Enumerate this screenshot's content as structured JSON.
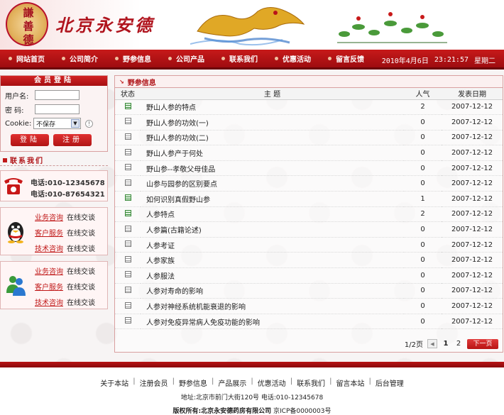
{
  "header": {
    "seal_chars": [
      "謙",
      "善",
      "德"
    ],
    "company_name": "北京永安德"
  },
  "nav": {
    "items": [
      "网站首页",
      "公司简介",
      "野参信息",
      "公司产品",
      "联系我们",
      "优惠活动",
      "留言反馈"
    ],
    "date": "2010年4月6日",
    "time": "23:21:57",
    "weekday": "星期二"
  },
  "login": {
    "title": "会员登陆",
    "username_label": "用户名:",
    "password_label": "密 码:",
    "cookie_label": "Cookie:",
    "cookie_value": "不保存",
    "login_button": "登陆",
    "register_button": "注册"
  },
  "contact": {
    "title": "联系我们",
    "phone1": "电话:010-12345678",
    "phone2": "电话:010-87654321",
    "qq_rows": [
      {
        "service": "业务咨询",
        "action": "在线交谈"
      },
      {
        "service": "客户服务",
        "action": "在线交谈"
      },
      {
        "service": "技术咨询",
        "action": "在线交谈"
      }
    ],
    "msn_rows": [
      {
        "service": "业务咨询",
        "action": "在线交谈"
      },
      {
        "service": "客户服务",
        "action": "在线交谈"
      },
      {
        "service": "技术咨询",
        "action": "在线交谈"
      }
    ]
  },
  "main": {
    "title": "野参信息",
    "columns": [
      "状态",
      "主 题",
      "人气",
      "发表日期"
    ],
    "rows": [
      {
        "status": "hot",
        "title": "野山人参的特点",
        "pop": "2",
        "date": "2007-12-12"
      },
      {
        "status": "normal",
        "title": "野山人参的功效(一)",
        "pop": "0",
        "date": "2007-12-12"
      },
      {
        "status": "normal",
        "title": "野山人参的功效(二)",
        "pop": "0",
        "date": "2007-12-12"
      },
      {
        "status": "normal",
        "title": "野山人参产于何处",
        "pop": "0",
        "date": "2007-12-12"
      },
      {
        "status": "normal",
        "title": "野山参--孝敬父母佳品",
        "pop": "0",
        "date": "2007-12-12"
      },
      {
        "status": "normal",
        "title": "山参与园参的区别要点",
        "pop": "0",
        "date": "2007-12-12"
      },
      {
        "status": "hot",
        "title": "如何识别真假野山参",
        "pop": "1",
        "date": "2007-12-12"
      },
      {
        "status": "hot",
        "title": "人参特点",
        "pop": "2",
        "date": "2007-12-12"
      },
      {
        "status": "normal",
        "title": "人参篇(古籍论述)",
        "pop": "0",
        "date": "2007-12-12"
      },
      {
        "status": "normal",
        "title": "人参考证",
        "pop": "0",
        "date": "2007-12-12"
      },
      {
        "status": "normal",
        "title": "人参家族",
        "pop": "0",
        "date": "2007-12-12"
      },
      {
        "status": "normal",
        "title": "人参服法",
        "pop": "0",
        "date": "2007-12-12"
      },
      {
        "status": "normal",
        "title": "人参对寿命的影响",
        "pop": "0",
        "date": "2007-12-12"
      },
      {
        "status": "normal",
        "title": "人参对神经系统机能衰退的影响",
        "pop": "0",
        "date": "2007-12-12"
      },
      {
        "status": "normal",
        "title": "人参对免疫异常病人免疫功能的影响",
        "pop": "0",
        "date": "2007-12-12"
      }
    ],
    "pager": {
      "page_info": "1/2页",
      "pages": [
        "1",
        "2"
      ],
      "next_label": "下一页"
    }
  },
  "footer": {
    "links": [
      "关于本站",
      "注册会员",
      "野参信息",
      "产品展示",
      "优惠活动",
      "联系我们",
      "留言本站",
      "后台管理"
    ],
    "address": "地址:北京市前门大街120号 电话:010-12345678",
    "copyright_label": "版权所有:北京永安德药房有限公司",
    "icp": "京ICP备0000003号"
  },
  "colors": {
    "brand_red": "#b01418",
    "nav_red": "#c71a1a"
  }
}
